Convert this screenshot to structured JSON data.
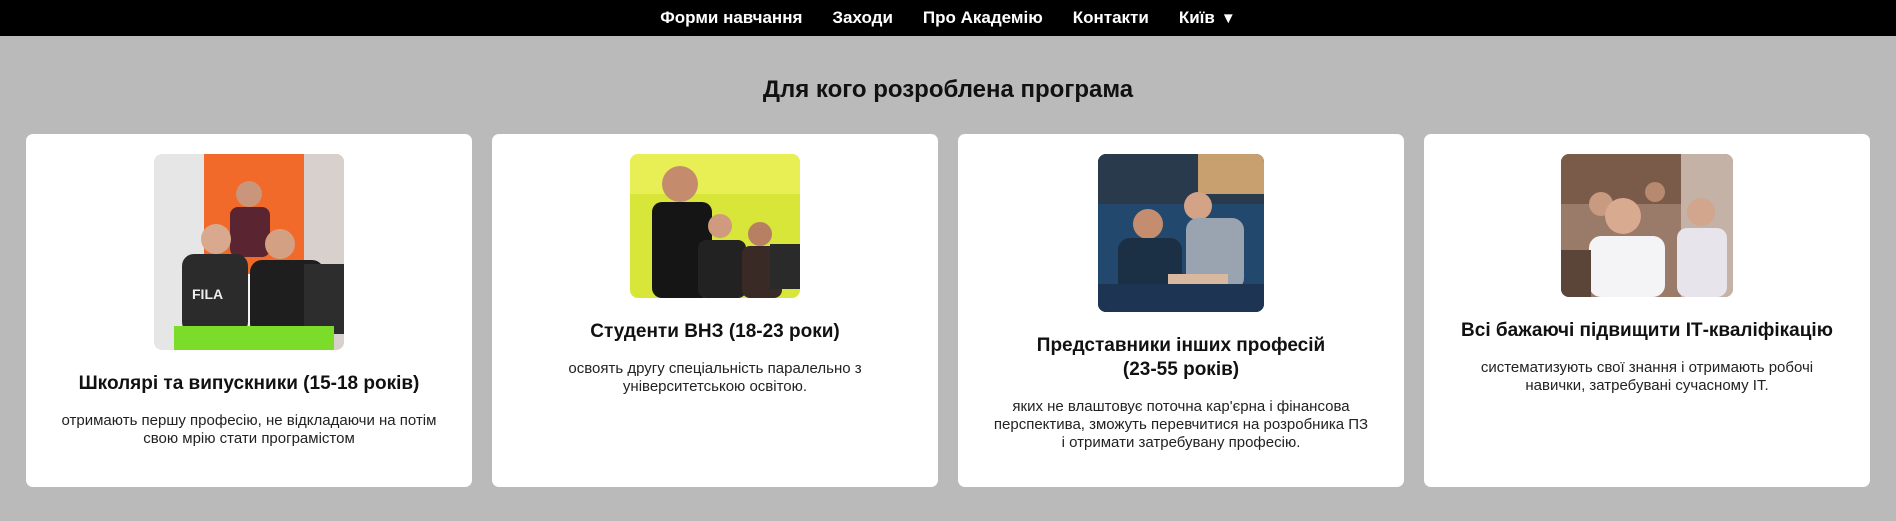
{
  "nav": {
    "items": [
      "Форми навчання",
      "Заходи",
      "Про Академію",
      "Контакти"
    ],
    "city": "Київ",
    "city_arrow": "▼"
  },
  "section": {
    "title": "Для кого розроблена програма"
  },
  "cards": [
    {
      "title": "Школярі та випускники (15-18 років)",
      "text": "отримають першу професію, не відкладаючи на потім свою мрію стати програмістом"
    },
    {
      "title": "Студенти ВНЗ (18-23 роки)",
      "text": "освоять другу спеціальність паралельно з університетською освітою."
    },
    {
      "title_line1": "Представники інших професій",
      "title_line2": "(23-55 років)",
      "text": "яких не влаштовує поточна кар'єрна і фінансова перспектива, зможуть перевчитися на розробника ПЗ і отримати затребувану професію."
    },
    {
      "title": "Всі бажаючі підвищити ІТ-кваліфікацію",
      "text": "систематизують свої знання і отримають робочі навички, затребувані сучасному ІТ."
    }
  ]
}
